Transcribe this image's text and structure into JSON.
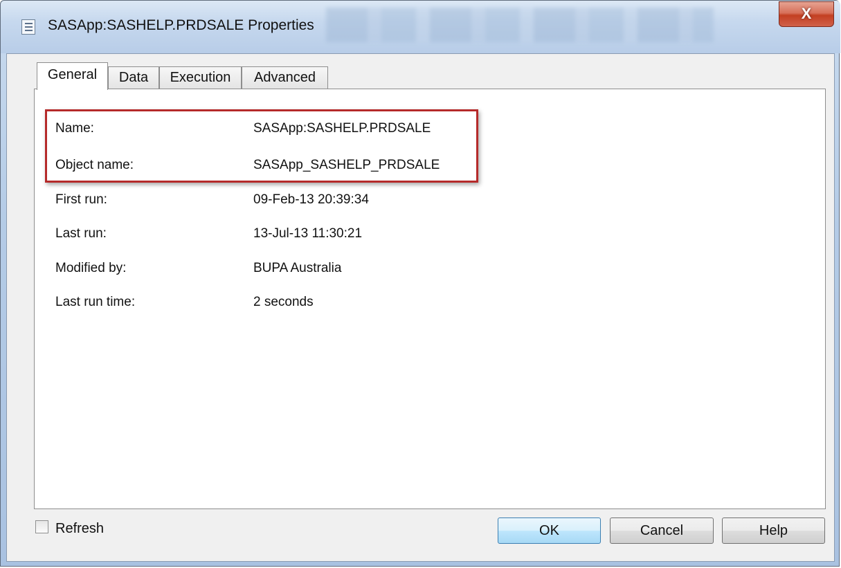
{
  "window": {
    "title": "SASApp:SASHELP.PRDSALE Properties",
    "close_glyph": "X"
  },
  "tabs": [
    {
      "label": "General",
      "active": true
    },
    {
      "label": "Data",
      "active": false
    },
    {
      "label": "Execution",
      "active": false
    },
    {
      "label": "Advanced",
      "active": false
    }
  ],
  "properties": [
    {
      "label": "Name:",
      "value": "SASApp:SASHELP.PRDSALE"
    },
    {
      "label": "Object name:",
      "value": "SASApp_SASHELP_PRDSALE"
    },
    {
      "label": "First run:",
      "value": "09-Feb-13 20:39:34"
    },
    {
      "label": "Last run:",
      "value": "13-Jul-13 11:30:21"
    },
    {
      "label": "Modified by:",
      "value": "BUPA Australia"
    },
    {
      "label": "Last run time:",
      "value": "2 seconds"
    }
  ],
  "footer": {
    "refresh_label": "Refresh",
    "refresh_checked": false,
    "ok_label": "OK",
    "cancel_label": "Cancel",
    "help_label": "Help"
  },
  "colors": {
    "highlight_box": "#b52a2a",
    "close_button": "#c33f22"
  }
}
